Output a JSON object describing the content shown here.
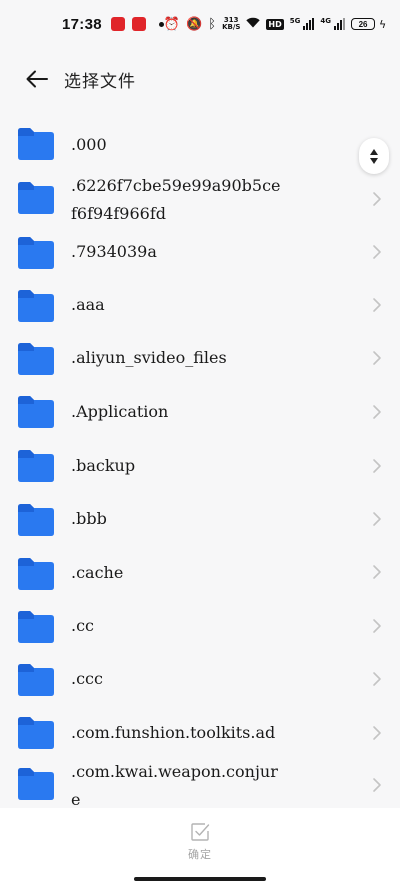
{
  "status_bar": {
    "time": "17:38",
    "net_speed_value": "313",
    "net_speed_unit": "KB/S",
    "hd_label": "HD",
    "network_1": "5G",
    "network_2": "4G",
    "battery": "26"
  },
  "header": {
    "title": "选择文件"
  },
  "files": [
    {
      "name": ".000"
    },
    {
      "name": ".6226f7cbe59e99a90b5cef6f94f966fd"
    },
    {
      "name": ".7934039a"
    },
    {
      "name": ".aaa"
    },
    {
      "name": ".aliyun_svideo_files"
    },
    {
      "name": ".Application"
    },
    {
      "name": ".backup"
    },
    {
      "name": ".bbb"
    },
    {
      "name": ".cache"
    },
    {
      "name": ".cc"
    },
    {
      "name": ".ccc"
    },
    {
      "name": ".com.funshion.toolkits.ad"
    },
    {
      "name": ".com.kwai.weapon.conjure"
    }
  ],
  "bottom": {
    "confirm_label": "确定"
  },
  "colors": {
    "folder": "#2a79f0",
    "folder_tab": "#1d63d8",
    "background": "#f7f7f8",
    "chevron": "#c4c4c4"
  }
}
